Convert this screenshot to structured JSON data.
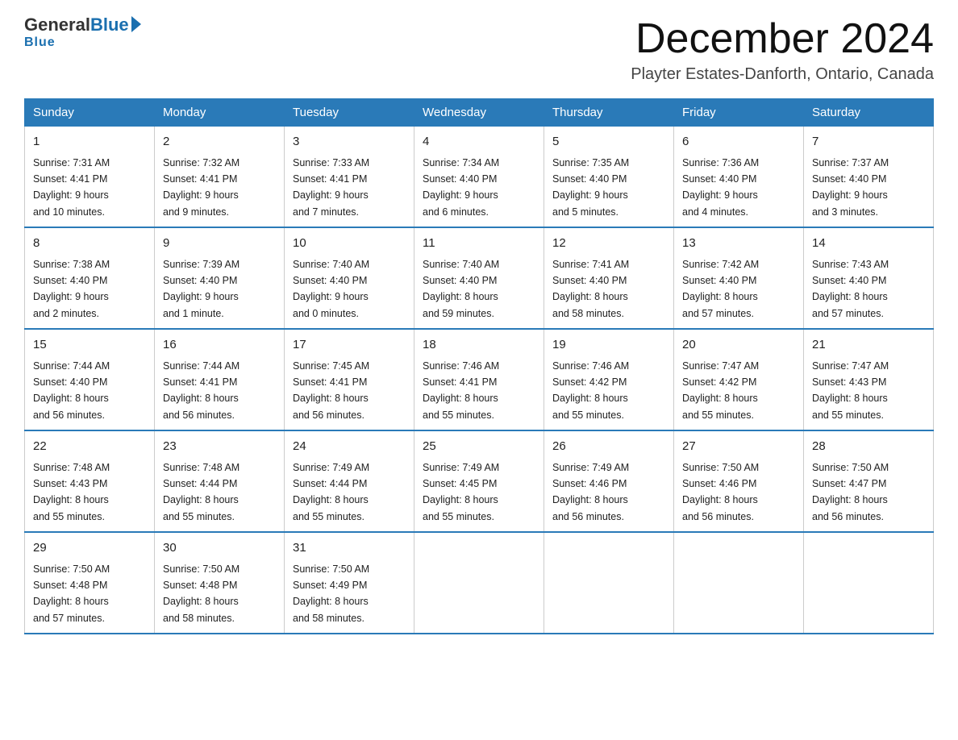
{
  "header": {
    "logo_general": "General",
    "logo_blue": "Blue",
    "month_title": "December 2024",
    "location": "Playter Estates-Danforth, Ontario, Canada"
  },
  "weekdays": [
    "Sunday",
    "Monday",
    "Tuesday",
    "Wednesday",
    "Thursday",
    "Friday",
    "Saturday"
  ],
  "weeks": [
    [
      {
        "day": "1",
        "sunrise": "7:31 AM",
        "sunset": "4:41 PM",
        "daylight": "9 hours and 10 minutes."
      },
      {
        "day": "2",
        "sunrise": "7:32 AM",
        "sunset": "4:41 PM",
        "daylight": "9 hours and 9 minutes."
      },
      {
        "day": "3",
        "sunrise": "7:33 AM",
        "sunset": "4:41 PM",
        "daylight": "9 hours and 7 minutes."
      },
      {
        "day": "4",
        "sunrise": "7:34 AM",
        "sunset": "4:40 PM",
        "daylight": "9 hours and 6 minutes."
      },
      {
        "day": "5",
        "sunrise": "7:35 AM",
        "sunset": "4:40 PM",
        "daylight": "9 hours and 5 minutes."
      },
      {
        "day": "6",
        "sunrise": "7:36 AM",
        "sunset": "4:40 PM",
        "daylight": "9 hours and 4 minutes."
      },
      {
        "day": "7",
        "sunrise": "7:37 AM",
        "sunset": "4:40 PM",
        "daylight": "9 hours and 3 minutes."
      }
    ],
    [
      {
        "day": "8",
        "sunrise": "7:38 AM",
        "sunset": "4:40 PM",
        "daylight": "9 hours and 2 minutes."
      },
      {
        "day": "9",
        "sunrise": "7:39 AM",
        "sunset": "4:40 PM",
        "daylight": "9 hours and 1 minute."
      },
      {
        "day": "10",
        "sunrise": "7:40 AM",
        "sunset": "4:40 PM",
        "daylight": "9 hours and 0 minutes."
      },
      {
        "day": "11",
        "sunrise": "7:40 AM",
        "sunset": "4:40 PM",
        "daylight": "8 hours and 59 minutes."
      },
      {
        "day": "12",
        "sunrise": "7:41 AM",
        "sunset": "4:40 PM",
        "daylight": "8 hours and 58 minutes."
      },
      {
        "day": "13",
        "sunrise": "7:42 AM",
        "sunset": "4:40 PM",
        "daylight": "8 hours and 57 minutes."
      },
      {
        "day": "14",
        "sunrise": "7:43 AM",
        "sunset": "4:40 PM",
        "daylight": "8 hours and 57 minutes."
      }
    ],
    [
      {
        "day": "15",
        "sunrise": "7:44 AM",
        "sunset": "4:40 PM",
        "daylight": "8 hours and 56 minutes."
      },
      {
        "day": "16",
        "sunrise": "7:44 AM",
        "sunset": "4:41 PM",
        "daylight": "8 hours and 56 minutes."
      },
      {
        "day": "17",
        "sunrise": "7:45 AM",
        "sunset": "4:41 PM",
        "daylight": "8 hours and 56 minutes."
      },
      {
        "day": "18",
        "sunrise": "7:46 AM",
        "sunset": "4:41 PM",
        "daylight": "8 hours and 55 minutes."
      },
      {
        "day": "19",
        "sunrise": "7:46 AM",
        "sunset": "4:42 PM",
        "daylight": "8 hours and 55 minutes."
      },
      {
        "day": "20",
        "sunrise": "7:47 AM",
        "sunset": "4:42 PM",
        "daylight": "8 hours and 55 minutes."
      },
      {
        "day": "21",
        "sunrise": "7:47 AM",
        "sunset": "4:43 PM",
        "daylight": "8 hours and 55 minutes."
      }
    ],
    [
      {
        "day": "22",
        "sunrise": "7:48 AM",
        "sunset": "4:43 PM",
        "daylight": "8 hours and 55 minutes."
      },
      {
        "day": "23",
        "sunrise": "7:48 AM",
        "sunset": "4:44 PM",
        "daylight": "8 hours and 55 minutes."
      },
      {
        "day": "24",
        "sunrise": "7:49 AM",
        "sunset": "4:44 PM",
        "daylight": "8 hours and 55 minutes."
      },
      {
        "day": "25",
        "sunrise": "7:49 AM",
        "sunset": "4:45 PM",
        "daylight": "8 hours and 55 minutes."
      },
      {
        "day": "26",
        "sunrise": "7:49 AM",
        "sunset": "4:46 PM",
        "daylight": "8 hours and 56 minutes."
      },
      {
        "day": "27",
        "sunrise": "7:50 AM",
        "sunset": "4:46 PM",
        "daylight": "8 hours and 56 minutes."
      },
      {
        "day": "28",
        "sunrise": "7:50 AM",
        "sunset": "4:47 PM",
        "daylight": "8 hours and 56 minutes."
      }
    ],
    [
      {
        "day": "29",
        "sunrise": "7:50 AM",
        "sunset": "4:48 PM",
        "daylight": "8 hours and 57 minutes."
      },
      {
        "day": "30",
        "sunrise": "7:50 AM",
        "sunset": "4:48 PM",
        "daylight": "8 hours and 58 minutes."
      },
      {
        "day": "31",
        "sunrise": "7:50 AM",
        "sunset": "4:49 PM",
        "daylight": "8 hours and 58 minutes."
      },
      null,
      null,
      null,
      null
    ]
  ],
  "labels": {
    "sunrise": "Sunrise:",
    "sunset": "Sunset:",
    "daylight": "Daylight:"
  }
}
